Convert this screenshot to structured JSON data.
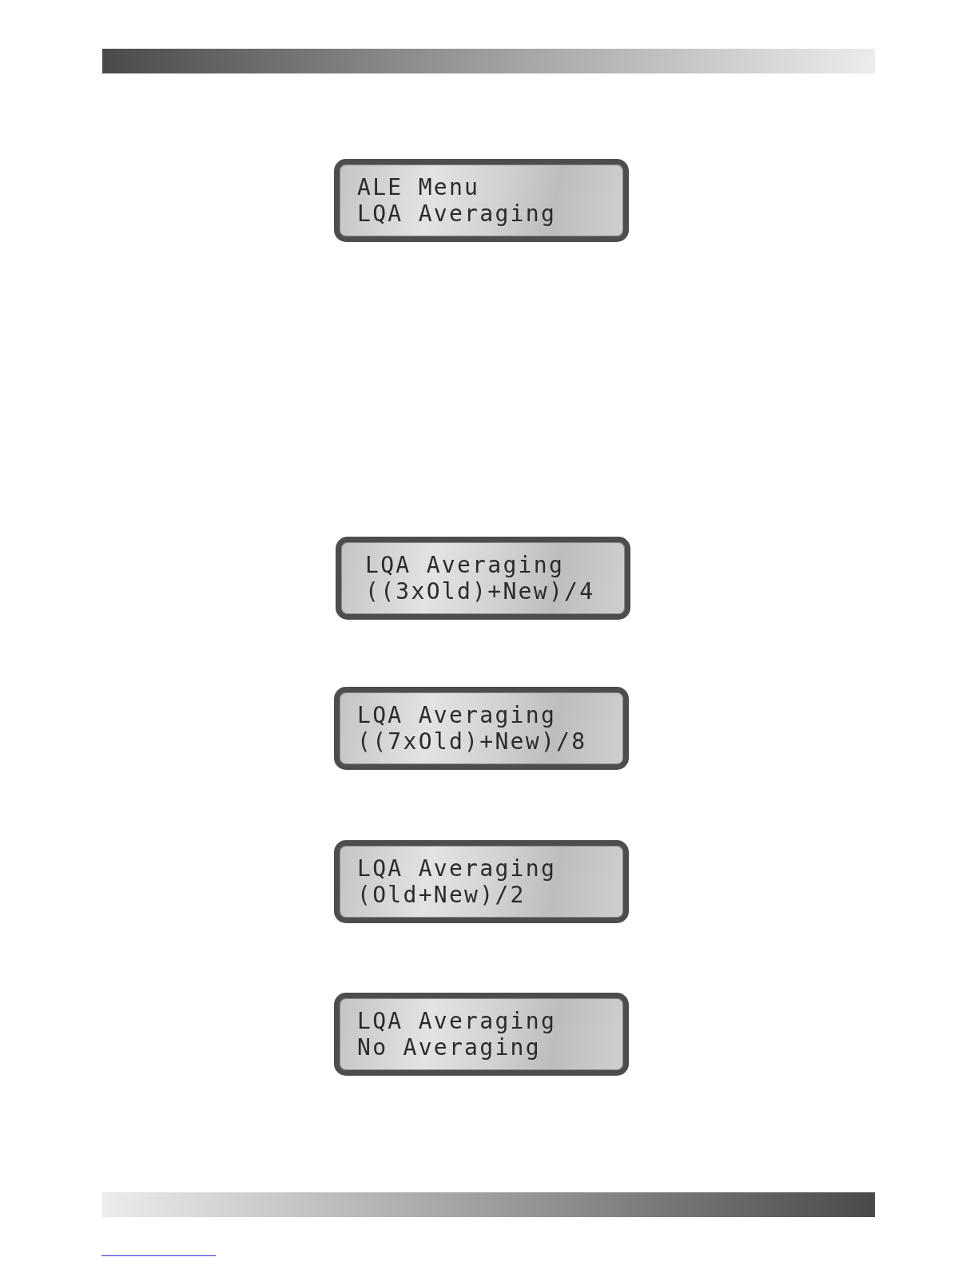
{
  "menu_display": {
    "lines": [
      "ALE Menu",
      "LQA Averaging"
    ]
  },
  "option_displays": [
    {
      "lines": [
        "LQA Averaging",
        "((3xOld)+New)/4"
      ]
    },
    {
      "lines": [
        "LQA Averaging",
        "((7xOld)+New)/8"
      ]
    },
    {
      "lines": [
        "LQA Averaging",
        "(Old+New)/2"
      ]
    },
    {
      "lines": [
        "LQA Averaging",
        "No Averaging"
      ]
    }
  ]
}
